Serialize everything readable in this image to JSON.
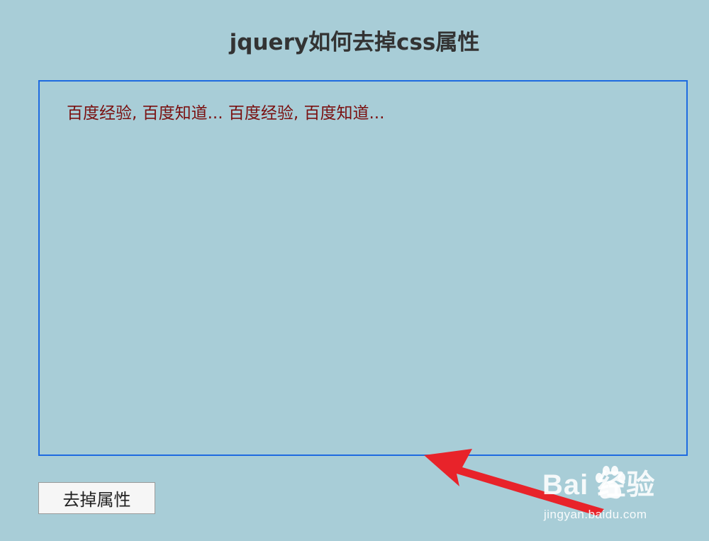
{
  "page": {
    "title": "jquery如何去掉css属性"
  },
  "content_box": {
    "text": "百度经验, 百度知道... 百度经验, 百度知道..."
  },
  "button": {
    "label": "去掉属性"
  },
  "watermark": {
    "brand": "Bai  经验",
    "url": "jingyan.baidu.com"
  },
  "colors": {
    "background": "#a8cdd7",
    "box_border": "#1e6be0",
    "content_text": "#7a1010",
    "title_text": "#333333",
    "arrow": "#e8232a"
  },
  "icons": {
    "watermark_logo": "baidu-paw-icon",
    "annotation": "red-arrow-icon"
  }
}
